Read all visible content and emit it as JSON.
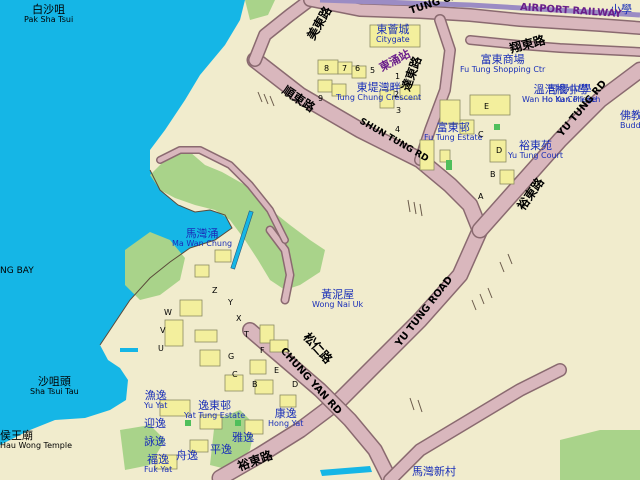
{
  "map": {
    "colors": {
      "sea": "#15b6e6",
      "land": "#f1eccd",
      "vegetation": "#a9d38a",
      "road": "#d9b7bd",
      "road_edge": "#8a6a70",
      "building": "#f3ef9d",
      "rail": "#9b8cc4"
    },
    "places": {
      "pak_sha_tsui": {
        "zh": "白沙咀",
        "en": "Pak Sha Tsui"
      },
      "ma_wan_chung": {
        "zh": "馬灣涌",
        "en": "Ma Wan Chung"
      },
      "sha_tsui_tau": {
        "zh": "沙咀頭",
        "en": "Sha Tsui Tau"
      },
      "hau_wong_temple": {
        "zh": "侯王廟",
        "en": "Hau Wong Temple"
      },
      "wong_nai_uk": {
        "zh": "黃泥屋",
        "en": "Wong Nai Uk"
      },
      "citygate": {
        "zh": "東薈城",
        "en": "Citygate"
      },
      "tung_chung_crescent": {
        "zh": "東堤灣畔",
        "en": "Tung Chung Crescent"
      },
      "fu_tung_shopping": {
        "zh": "富東商場",
        "en": "Fu Tung Shopping Ctr"
      },
      "fu_tung_estate": {
        "zh": "富東邨",
        "en": "Fu Tung Estate"
      },
      "wan_ho_kan": {
        "zh": "溫浩根小學",
        "en": "Wan Ho Kan Pri Sch"
      },
      "ho_yu_college": {
        "zh": "可譽中學",
        "en": "Ho Yu College"
      },
      "yu_tung_court": {
        "zh": "裕東苑",
        "en": "Yu Tung Court"
      },
      "buddhist": {
        "zh": "佛教",
        "en": "Budd C"
      },
      "yat_tung_estate": {
        "zh": "逸東邨",
        "en": "Yat Tung Estate"
      },
      "yu_yat": {
        "zh": "漁逸",
        "en": "Yu Yat"
      },
      "hong_yat": {
        "zh": "康逸",
        "en": "Hong Yat"
      },
      "fuk_yat": {
        "zh": "福逸",
        "en": "Fuk Yat"
      },
      "ying_yat": {
        "zh": "迎逸",
        "en": ""
      },
      "wing_yat": {
        "zh": "詠逸",
        "en": ""
      },
      "chun_yat": {
        "zh": "舟逸",
        "en": ""
      },
      "ping_yat": {
        "zh": "平逸",
        "en": ""
      },
      "nga_yat": {
        "zh": "雅逸",
        "en": ""
      },
      "ma_wan_new_village": {
        "zh": "馬灣新村",
        "en": ""
      },
      "xiao_xue_top": {
        "zh": "小學",
        "en": ""
      },
      "bay": {
        "zh": "",
        "en": "NG BAY"
      }
    },
    "roads": {
      "tung_chung_road_top": "TUNG CHUNG",
      "airport_railway": "AIRPORT RAILWAY",
      "tung_chung_line_zh": "東涌站",
      "shun_tung_rd": "SHUN TUNG RD",
      "shun_tung_zh": "順東路",
      "yu_tung_road": "YU TUNG ROAD",
      "yu_tung_rd_ne": "YU TUNG RD",
      "yu_tung_zh": "裕東路",
      "yu_tung_zh_bottom": "裕東路",
      "chung_yan_rd": "CHUNG YAN RD",
      "chung_yan_zh": "松仁路",
      "tat_tung_zh": "達東路",
      "mei_tung_zh": "美東路",
      "cheung_tung_zh": "翔東路"
    },
    "blocks": [
      "8",
      "7",
      "6",
      "5",
      "1",
      "2",
      "3",
      "4",
      "9",
      "E",
      "C",
      "D",
      "B",
      "A",
      "Z",
      "Y",
      "X",
      "W",
      "V",
      "U",
      "T",
      "F",
      "E",
      "D",
      "G",
      "B",
      "C"
    ]
  }
}
